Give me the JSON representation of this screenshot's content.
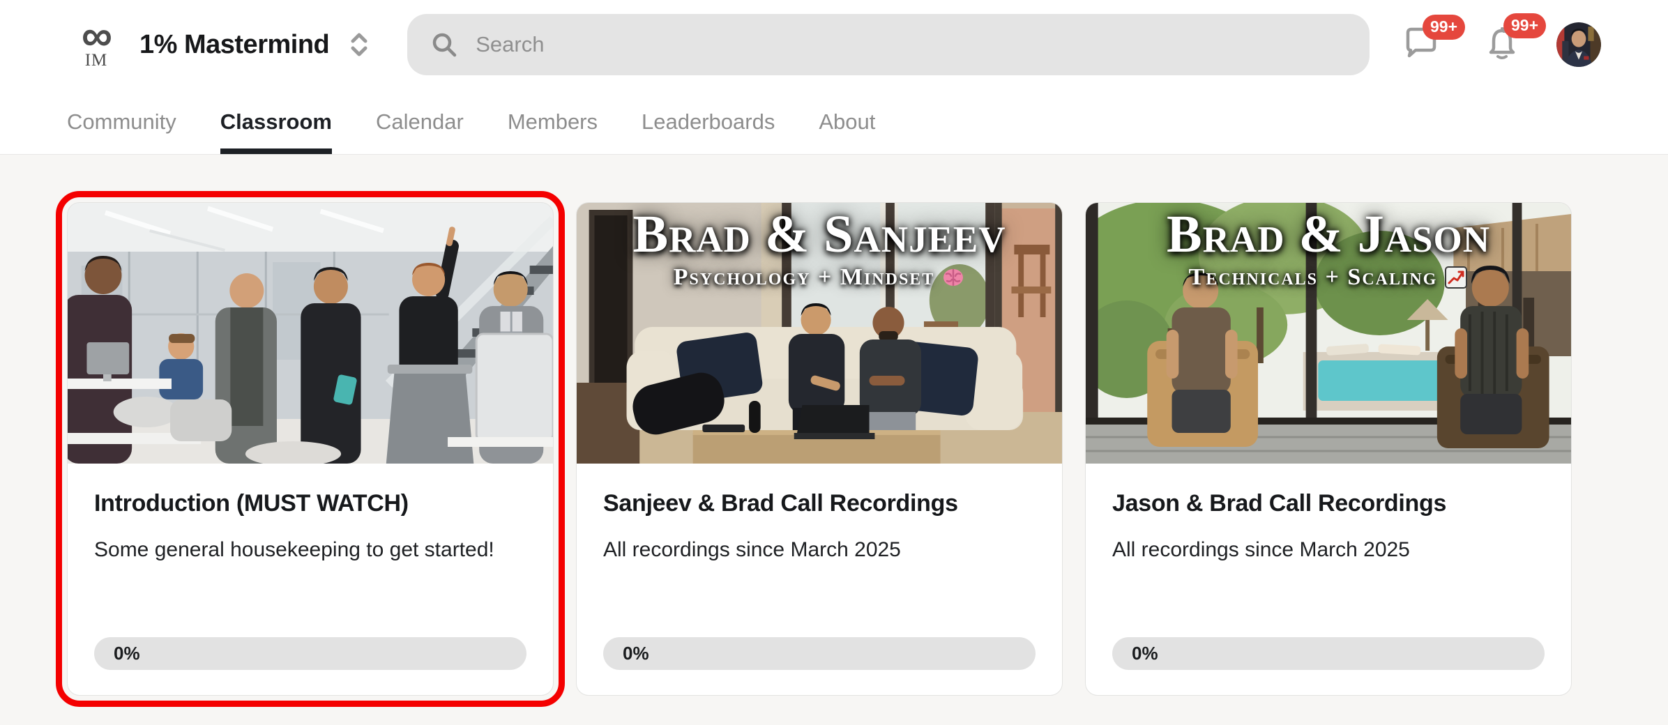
{
  "header": {
    "logo_symbol": "∞",
    "logo_monogram": "IM",
    "community_name": "1% Mastermind",
    "search_placeholder": "Search",
    "chat_badge": "99+",
    "notifications_badge": "99+"
  },
  "nav": {
    "tabs": [
      {
        "label": "Community",
        "active": false
      },
      {
        "label": "Classroom",
        "active": true
      },
      {
        "label": "Calendar",
        "active": false
      },
      {
        "label": "Members",
        "active": false
      },
      {
        "label": "Leaderboards",
        "active": false
      },
      {
        "label": "About",
        "active": false
      }
    ]
  },
  "classroom": {
    "courses": [
      {
        "title": "Introduction (MUST WATCH)",
        "description": "Some general housekeeping to get started!",
        "progress_label": "0%",
        "progress_percent": 0,
        "highlighted": true,
        "cover": {
          "scene": "office-team-meeting",
          "overlay_title": "",
          "overlay_subtitle": "",
          "emoji_icon": ""
        }
      },
      {
        "title": "Sanjeev & Brad Call Recordings",
        "description": "All recordings since March 2025",
        "progress_label": "0%",
        "progress_percent": 0,
        "highlighted": false,
        "cover": {
          "scene": "living-room-couch",
          "overlay_title": "Brad & Sanjeev",
          "overlay_subtitle": "Psychology + Mindset",
          "emoji_icon": "brain"
        }
      },
      {
        "title": "Jason & Brad Call Recordings",
        "description": "All recordings since March 2025",
        "progress_label": "0%",
        "progress_percent": 0,
        "highlighted": false,
        "cover": {
          "scene": "tropical-villa",
          "overlay_title": "Brad & Jason",
          "overlay_subtitle": "Technicals + Scaling",
          "emoji_icon": "chart-increasing"
        }
      }
    ]
  },
  "colors": {
    "badge_red": "#e5473d",
    "highlight_border": "#f40000",
    "active_tab": "#1d2025",
    "inactive_tab": "#8d8d8d",
    "page_background": "#f7f6f4"
  }
}
